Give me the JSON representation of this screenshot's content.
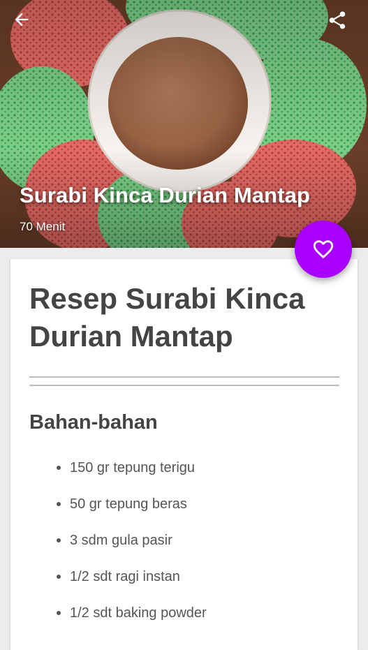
{
  "header": {
    "title": "Surabi Kinca Durian Mantap",
    "duration": "70 Menit",
    "back_icon": "arrow-left-icon",
    "share_icon": "share-icon"
  },
  "fab": {
    "icon": "heart-outline-icon",
    "color": "#aa00ff"
  },
  "recipe": {
    "title": "Resep Surabi Kinca Durian Mantap",
    "section_title": "Bahan-bahan",
    "ingredients": [
      "150 gr tepung terigu",
      "50 gr tepung beras",
      "3 sdm gula pasir",
      "1/2 sdt ragi instan",
      "1/2 sdt baking powder"
    ]
  }
}
